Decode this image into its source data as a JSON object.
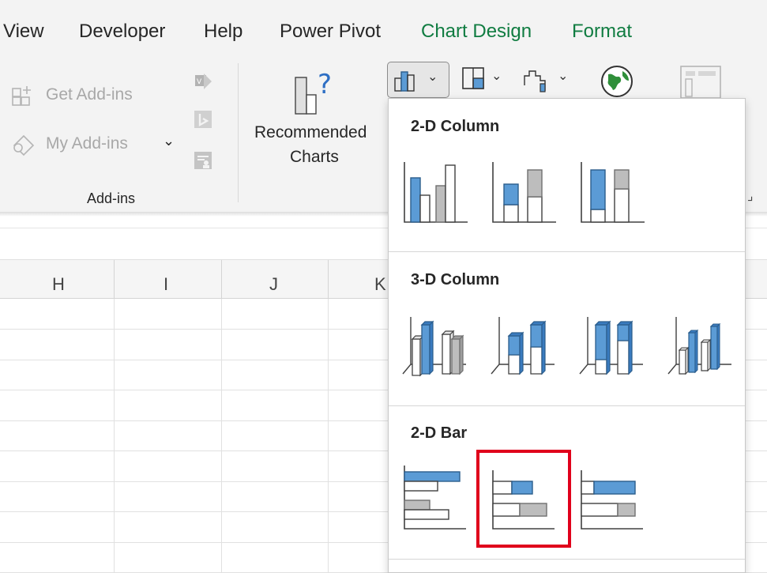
{
  "tabs": [
    "View",
    "Developer",
    "Help",
    "Power Pivot",
    "Chart Design",
    "Format"
  ],
  "ribbon": {
    "get_addins": "Get Add-ins",
    "my_addins": "My Add-ins",
    "addins_group": "Add-ins",
    "recommended_line1": "Recommended",
    "recommended_line2": "Charts"
  },
  "grid": {
    "columns": [
      "H",
      "I",
      "J",
      "K"
    ]
  },
  "dropdown": {
    "sections": [
      {
        "title": "2-D Column",
        "items": [
          "clustered-column",
          "stacked-column",
          "100-stacked-column"
        ]
      },
      {
        "title": "3-D Column",
        "items": [
          "3d-clustered-column",
          "3d-stacked-column",
          "3d-100-stacked-column",
          "3d-column"
        ]
      },
      {
        "title": "2-D Bar",
        "items": [
          "clustered-bar",
          "stacked-bar",
          "100-stacked-bar"
        ]
      }
    ],
    "highlighted_item": "stacked-bar"
  },
  "colors": {
    "accent_green": "#107c41",
    "chart_blue": "#5b9bd5",
    "chart_gray": "#bdbdbd",
    "highlight_red": "#e0001b"
  }
}
